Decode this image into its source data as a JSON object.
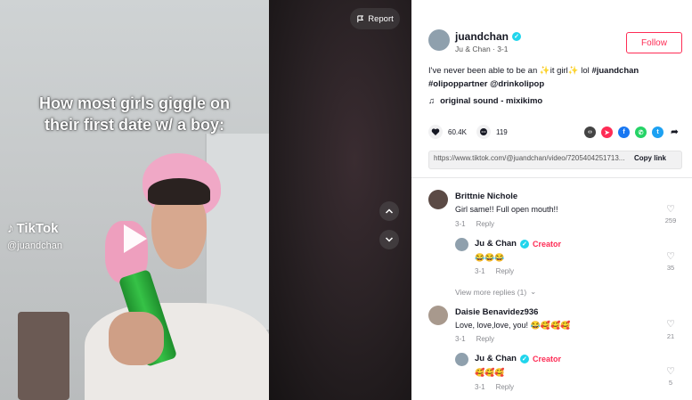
{
  "video": {
    "caption_line1": "How most girls giggle on",
    "caption_line2": "their first date w/ a boy:",
    "watermark_brand": "TikTok",
    "watermark_user": "@juandchan",
    "report_label": "Report"
  },
  "author": {
    "username": "juandchan",
    "display_line": "Ju & Chan · 3-1",
    "follow_label": "Follow"
  },
  "description": {
    "text_before": "I've never been able to be an ",
    "sparkle1": "✨",
    "it_girl": "it girl",
    "sparkle2": "✨",
    "text_after": " lol ",
    "hashtag1": "#juandchan",
    "hashtag2": "#olipoppartner",
    "mention": "@drinkolipop"
  },
  "sound": {
    "label": "original sound - mixikimo"
  },
  "stats": {
    "likes": "60.4K",
    "comments": "119"
  },
  "link": {
    "url": "https://www.tiktok.com/@juandchan/video/7205404251713...",
    "copy_label": "Copy link"
  },
  "comments": [
    {
      "name": "Brittnie Nichole",
      "text": "Girl same!! Full open mouth!!",
      "date": "3-1",
      "reply": "Reply",
      "likes": "259"
    },
    {
      "name": "Ju & Chan",
      "badge": "Creator",
      "text": "😂😂😂",
      "date": "3-1",
      "reply": "Reply",
      "likes": "35"
    },
    {
      "name": "Daisie Benavidez936",
      "text": "Love, love,love, you! 😂🥰🥰🥰",
      "date": "3-1",
      "reply": "Reply",
      "likes": "21"
    },
    {
      "name": "Ju & Chan",
      "badge": "Creator",
      "text": "🥰🥰🥰",
      "date": "3-1",
      "reply": "Reply",
      "likes": "5"
    }
  ],
  "view_more_replies": "View more replies (1)",
  "colors": {
    "accent": "#fe2c55",
    "verified": "#20d5ec"
  }
}
